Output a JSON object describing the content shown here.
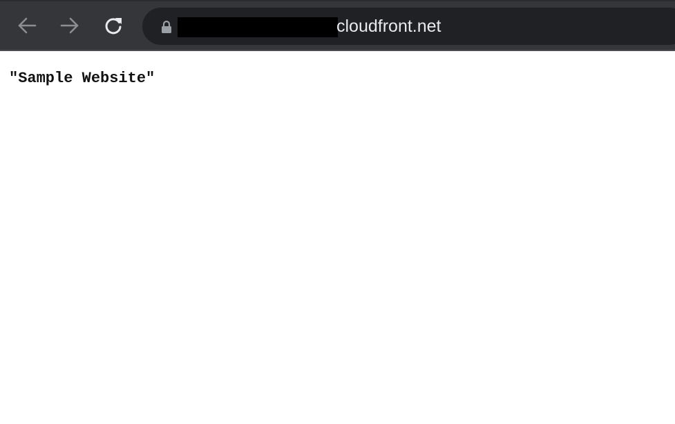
{
  "browser": {
    "toolbar": {
      "back_icon": "arrow-left-icon",
      "forward_icon": "arrow-right-icon",
      "reload_icon": "reload-icon"
    },
    "address_bar": {
      "security_icon": "lock-icon",
      "url_visible": "cloudfront.net"
    }
  },
  "page": {
    "body_text": "\"Sample Website\""
  },
  "colors": {
    "toolbar_bg": "#35363a",
    "omnibox_bg": "#202124",
    "url_text": "#e8eaed",
    "icon_disabled": "#8d8e90",
    "icon_enabled": "#e8eaed",
    "page_bg": "#ffffff"
  }
}
